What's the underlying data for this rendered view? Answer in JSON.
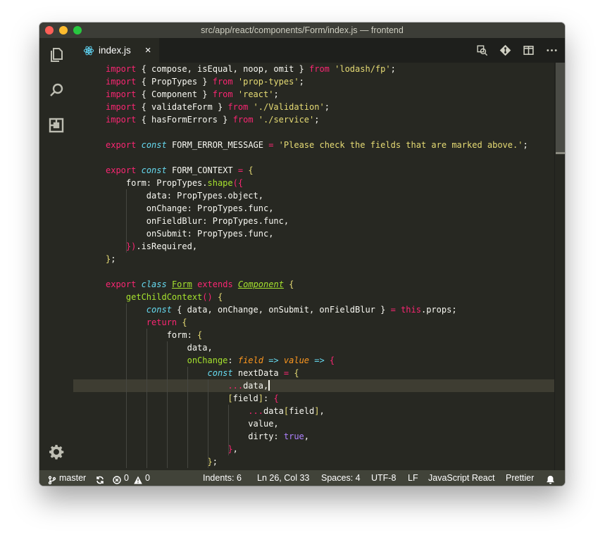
{
  "window": {
    "title": "src/app/react/components/Form/index.js — frontend"
  },
  "activity_bar": [
    {
      "icon": "files-icon"
    },
    {
      "icon": "search-icon"
    },
    {
      "icon": "extensions-icon"
    },
    {
      "icon": "gear-icon"
    }
  ],
  "tab": {
    "label": "index.js",
    "close": "×"
  },
  "tab_actions": [
    "open-changes-icon",
    "git-compare-icon",
    "split-editor-icon",
    "more-icon"
  ],
  "code": [
    [
      [
        "k",
        "import"
      ],
      [
        "n",
        " { compose, isEqual, noop, omit } "
      ],
      [
        "k",
        "from"
      ],
      [
        "s",
        " 'lodash/fp'"
      ],
      [
        "n",
        ";"
      ]
    ],
    [
      [
        "k",
        "import"
      ],
      [
        "n",
        " { PropTypes } "
      ],
      [
        "k",
        "from"
      ],
      [
        "s",
        " 'prop-types'"
      ],
      [
        "n",
        ";"
      ]
    ],
    [
      [
        "k",
        "import"
      ],
      [
        "n",
        " { Component } "
      ],
      [
        "k",
        "from"
      ],
      [
        "s",
        " 'react'"
      ],
      [
        "n",
        ";"
      ]
    ],
    [
      [
        "k",
        "import"
      ],
      [
        "n",
        " { validateForm } "
      ],
      [
        "k",
        "from"
      ],
      [
        "s",
        " './Validation'"
      ],
      [
        "n",
        ";"
      ]
    ],
    [
      [
        "k",
        "import"
      ],
      [
        "n",
        " { hasFormErrors } "
      ],
      [
        "k",
        "from"
      ],
      [
        "s",
        " './service'"
      ],
      [
        "n",
        ";"
      ]
    ],
    [],
    [
      [
        "k",
        "export"
      ],
      [
        "n",
        " "
      ],
      [
        "t",
        "const"
      ],
      [
        "n",
        " FORM_ERROR_MESSAGE "
      ],
      [
        "k",
        "="
      ],
      [
        "s",
        " 'Please check the fields that are marked above.'"
      ],
      [
        "n",
        ";"
      ]
    ],
    [],
    [
      [
        "k",
        "export"
      ],
      [
        "n",
        " "
      ],
      [
        "t",
        "const"
      ],
      [
        "n",
        " FORM_CONTEXT "
      ],
      [
        "k",
        "="
      ],
      [
        "y",
        " {"
      ]
    ],
    [
      [
        "n",
        "    form: PropTypes."
      ],
      [
        "f",
        "shape"
      ],
      [
        "m",
        "({"
      ]
    ],
    [
      [
        "n",
        "        data: PropTypes.object,"
      ]
    ],
    [
      [
        "n",
        "        onChange: PropTypes.func,"
      ]
    ],
    [
      [
        "n",
        "        onFieldBlur: PropTypes.func,"
      ]
    ],
    [
      [
        "n",
        "        onSubmit: PropTypes.func,"
      ]
    ],
    [
      [
        "n",
        "    "
      ],
      [
        "m",
        "})"
      ],
      [
        "n",
        ".isRequired,"
      ]
    ],
    [
      [
        "y",
        "}"
      ],
      [
        "n",
        ";"
      ]
    ],
    [],
    [
      [
        "k",
        "export"
      ],
      [
        "n",
        " "
      ],
      [
        "t",
        "class"
      ],
      [
        "n",
        " "
      ],
      [
        "u",
        "Form"
      ],
      [
        "n",
        " "
      ],
      [
        "k",
        "extends"
      ],
      [
        "n",
        " "
      ],
      [
        "ui",
        "Component"
      ],
      [
        "y",
        " {"
      ]
    ],
    [
      [
        "n",
        "    "
      ],
      [
        "f",
        "getChildContext"
      ],
      [
        "m",
        "()"
      ],
      [
        "y",
        " {"
      ]
    ],
    [
      [
        "n",
        "        "
      ],
      [
        "t",
        "const"
      ],
      [
        "n",
        " { data, onChange, onSubmit, onFieldBlur } "
      ],
      [
        "k",
        "="
      ],
      [
        "n",
        " "
      ],
      [
        "k",
        "this"
      ],
      [
        "n",
        ".props;"
      ]
    ],
    [
      [
        "n",
        "        "
      ],
      [
        "k",
        "return"
      ],
      [
        "y",
        " {"
      ]
    ],
    [
      [
        "n",
        "            form: "
      ],
      [
        "y",
        "{"
      ]
    ],
    [
      [
        "n",
        "                data,"
      ]
    ],
    [
      [
        "n",
        "                "
      ],
      [
        "f",
        "onChange"
      ],
      [
        "n",
        ": "
      ],
      [
        "p",
        "field"
      ],
      [
        "n",
        " "
      ],
      [
        "t",
        "=>"
      ],
      [
        "n",
        " "
      ],
      [
        "p",
        "value"
      ],
      [
        "n",
        " "
      ],
      [
        "t",
        "=>"
      ],
      [
        "m",
        " {"
      ]
    ],
    [
      [
        "n",
        "                    "
      ],
      [
        "t",
        "const"
      ],
      [
        "n",
        " nextData "
      ],
      [
        "k",
        "="
      ],
      [
        "n",
        " "
      ],
      [
        "y",
        "{"
      ]
    ],
    [
      [
        "n",
        "                        "
      ],
      [
        "k",
        "..."
      ],
      [
        "n",
        "data,"
      ],
      [
        "cursor",
        ""
      ]
    ],
    [
      [
        "n",
        "                        "
      ],
      [
        "y",
        "["
      ],
      [
        "n",
        "field"
      ],
      [
        "y",
        "]"
      ],
      [
        "n",
        ": "
      ],
      [
        "m",
        "{"
      ]
    ],
    [
      [
        "n",
        "                            "
      ],
      [
        "k",
        "..."
      ],
      [
        "n",
        "data"
      ],
      [
        "y",
        "["
      ],
      [
        "n",
        "field"
      ],
      [
        "y",
        "]"
      ],
      [
        "n",
        ","
      ]
    ],
    [
      [
        "n",
        "                            value,"
      ]
    ],
    [
      [
        "n",
        "                            dirty: "
      ],
      [
        "c",
        "true"
      ],
      [
        "n",
        ","
      ]
    ],
    [
      [
        "n",
        "                        "
      ],
      [
        "m",
        "}"
      ],
      [
        "n",
        ","
      ]
    ],
    [
      [
        "n",
        "                    "
      ],
      [
        "y",
        "}"
      ],
      [
        "n",
        ";"
      ]
    ]
  ],
  "status": {
    "branch": "master",
    "errors": "0",
    "warnings": "0",
    "indents": "Indents: 6",
    "position": "Ln 26, Col 33",
    "spaces": "Spaces: 4",
    "encoding": "UTF-8",
    "eol": "LF",
    "language": "JavaScript React",
    "formatter": "Prettier"
  }
}
